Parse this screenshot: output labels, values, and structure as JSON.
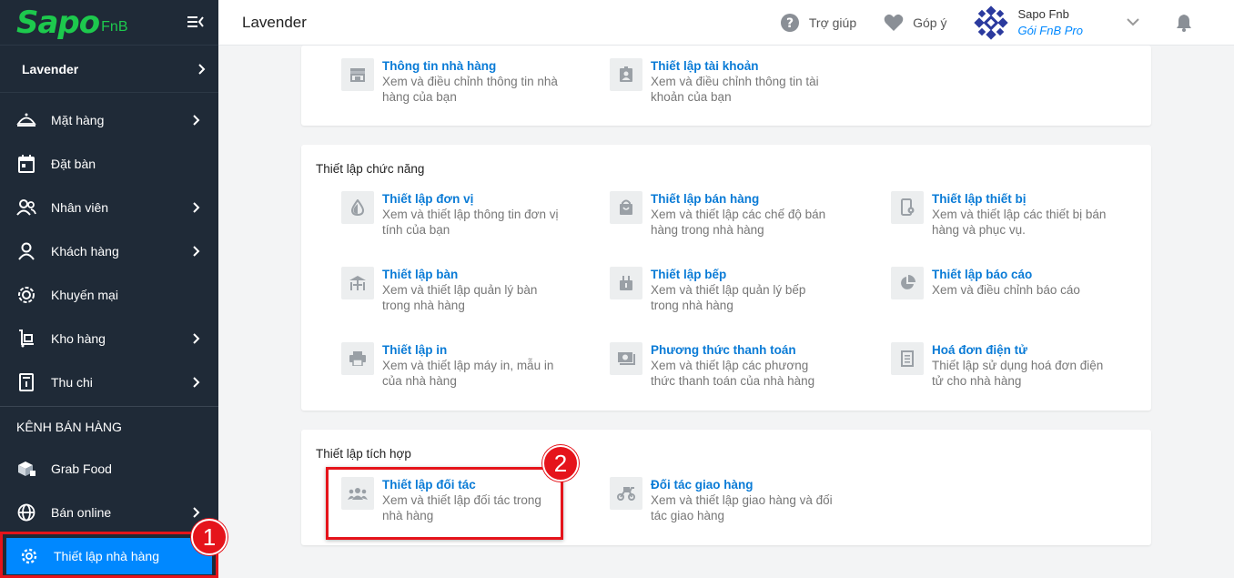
{
  "app": {
    "logo_main": "Sapo",
    "logo_sub": "FnB",
    "store_name": "Lavender",
    "page_title": "Lavender"
  },
  "sidebar": {
    "items": [
      {
        "label": "Mặt hàng",
        "icon": "food-cover-icon",
        "has_chevron": true
      },
      {
        "label": "Đặt bàn",
        "icon": "calendar-icon",
        "has_chevron": false
      },
      {
        "label": "Nhân viên",
        "icon": "users-icon",
        "has_chevron": true
      },
      {
        "label": "Khách hàng",
        "icon": "user-icon",
        "has_chevron": true
      },
      {
        "label": "Khuyến mại",
        "icon": "promo-gear-icon",
        "has_chevron": false
      },
      {
        "label": "Kho hàng",
        "icon": "cart-box-icon",
        "has_chevron": true
      },
      {
        "label": "Thu chi",
        "icon": "receipt-icon",
        "has_chevron": true
      }
    ],
    "channel_section_title": "KÊNH BÁN HÀNG",
    "channel_items": [
      {
        "label": "Grab Food",
        "icon": "boxes-icon",
        "has_chevron": false
      },
      {
        "label": "Bán online",
        "icon": "globe-icon",
        "has_chevron": true
      }
    ],
    "active_item": {
      "label": "Thiết lập nhà hàng",
      "icon": "gear-icon"
    }
  },
  "header": {
    "help_label": "Trợ giúp",
    "feedback_label": "Góp ý",
    "user_name": "Sapo Fnb",
    "user_plan": "Gói FnB Pro"
  },
  "sections": {
    "general": {
      "tiles": [
        {
          "title": "Thông tin nhà hàng",
          "desc": "Xem và điều chỉnh thông tin nhà hàng của bạn"
        },
        {
          "title": "Thiết lập tài khoản",
          "desc": "Xem và điều chỉnh thông tin tài khoản của bạn"
        }
      ]
    },
    "functions": {
      "title": "Thiết lập chức năng",
      "tiles": [
        {
          "title": "Thiết lập đơn vị",
          "desc": "Xem và thiết lập thông tin đơn vị tính của bạn"
        },
        {
          "title": "Thiết lập bán hàng",
          "desc": "Xem và thiết lập các chế độ bán hàng trong nhà hàng"
        },
        {
          "title": "Thiết lập thiết bị",
          "desc": "Xem và thiết lập các thiết bị bán hàng và phục vụ."
        },
        {
          "title": "Thiết lập bàn",
          "desc": "Xem và thiết lập quản lý bàn trong nhà hàng"
        },
        {
          "title": "Thiết lập bếp",
          "desc": "Xem và thiết lập quản lý bếp trong nhà hàng"
        },
        {
          "title": "Thiết lập báo cáo",
          "desc": "Xem và điều chỉnh báo cáo"
        },
        {
          "title": "Thiết lập in",
          "desc": "Xem và thiết lập máy in, mẫu in của nhà hàng"
        },
        {
          "title": "Phương thức thanh toán",
          "desc": "Xem và thiết lập các phương thức thanh toán của nhà hàng"
        },
        {
          "title": "Hoá đơn điện tử",
          "desc": "Thiết lập sử dụng hoá đơn điện tử cho nhà hàng"
        }
      ]
    },
    "integrations": {
      "title": "Thiết lập tích hợp",
      "tiles": [
        {
          "title": "Thiết lập đối tác",
          "desc": "Xem và thiết lập đối tác trong nhà hàng"
        },
        {
          "title": "Đối tác giao hàng",
          "desc": "Xem và thiết lập giao hàng và đối tác giao hàng"
        }
      ]
    }
  },
  "annotations": {
    "step1": "1",
    "step2": "2"
  },
  "colors": {
    "sidebar_bg": "#1f2a37",
    "accent": "#0088ff",
    "brand_green": "#1dc94d",
    "annotation_red": "#e5141b",
    "link_blue": "#0a7bd6"
  }
}
